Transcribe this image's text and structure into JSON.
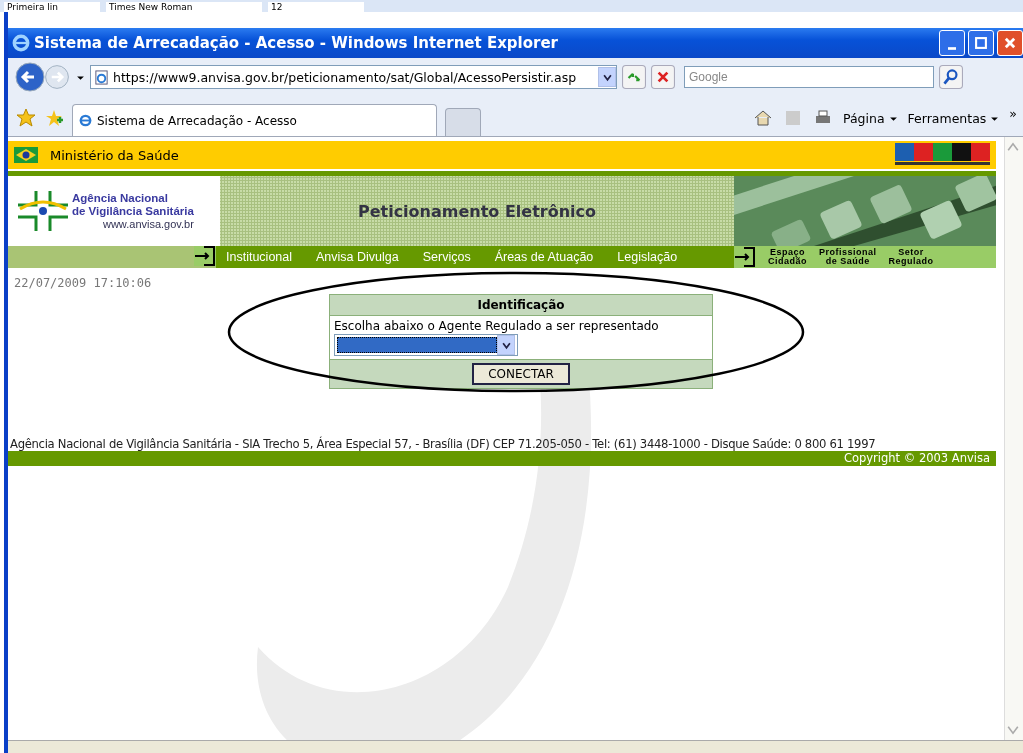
{
  "word_toolbar": {
    "style": "Primeira lin",
    "font": "Times New Roman",
    "size": "12"
  },
  "window": {
    "title": "Sistema de Arrecadação - Acesso - Windows Internet Explorer"
  },
  "address_bar": {
    "url": "https://www9.anvisa.gov.br/peticionamento/sat/Global/AcessoPersistir.asp",
    "search_placeholder": "Google"
  },
  "tabs": [
    {
      "label": "Sistema de Arrecadação - Acesso",
      "selected": true
    }
  ],
  "command_bar": {
    "page": "Página",
    "tools": "Ferramentas",
    "more": "»"
  },
  "page": {
    "ministry": "Ministério da Saúde",
    "logo": {
      "line1": "Agência Nacional",
      "line2": "de Vigilância Sanitária",
      "url": "www.anvisa.gov.br"
    },
    "banner_title": "Peticionamento Eletrônico",
    "nav": [
      "Institucional",
      "Anvisa Divulga",
      "Serviços",
      "Áreas de Atuação",
      "Legislação"
    ],
    "audience": [
      {
        "line1": "Espaço",
        "line2": "Cidadão"
      },
      {
        "line1": "Profissional",
        "line2": "de Saúde"
      },
      {
        "line1": "Setor",
        "line2": "Regulado"
      }
    ],
    "datetime": "22/07/2009 17:10:06",
    "form": {
      "title": "Identificação",
      "prompt": "Escolha abaixo o Agente Regulado a ser representado",
      "button": "CONECTAR"
    },
    "footer": {
      "address": "Agência Nacional de Vigilância Sanitária - SIA Trecho 5, Área Especial 57, - Brasília (DF) CEP 71.205-050 - Tel: (61) 3448-1000 - Disque Saúde: 0 800 61 1997",
      "copyright": "Copyright © 2003 Anvisa"
    }
  }
}
